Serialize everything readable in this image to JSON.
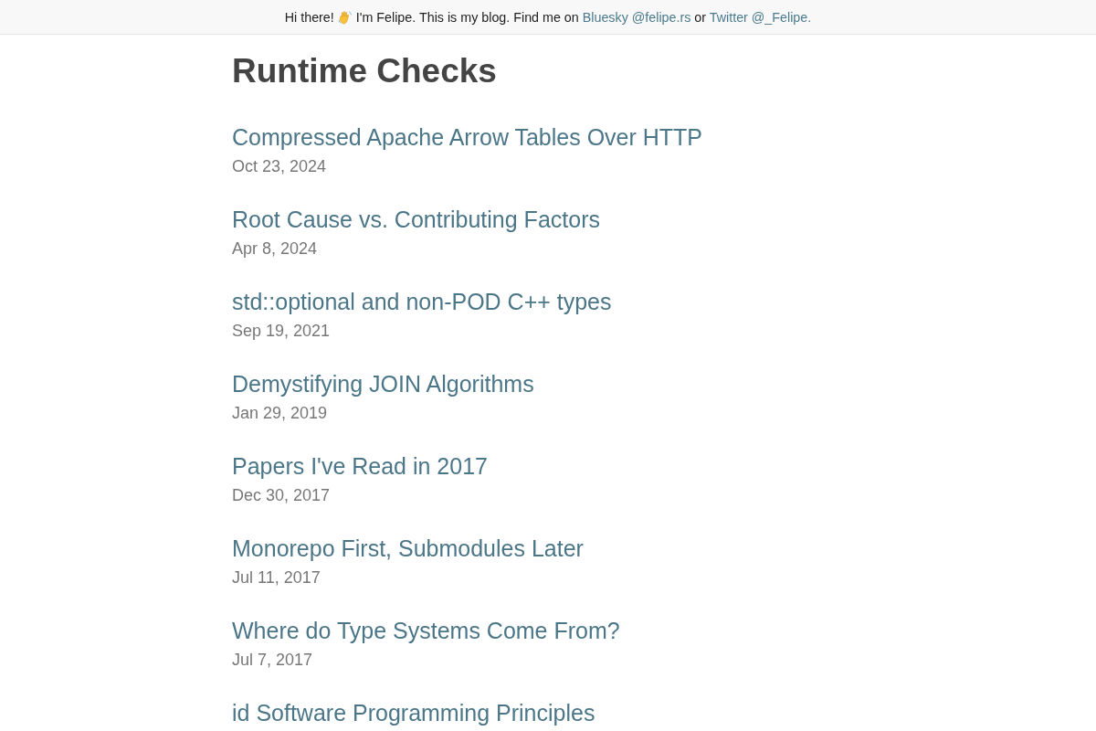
{
  "banner": {
    "greeting": "Hi there!",
    "intro": "I'm Felipe. This is my blog. Find me on",
    "links": [
      {
        "label": "Bluesky @felipe.rs"
      },
      {
        "label": "Twitter @_Felipe."
      }
    ],
    "conjunction": "or"
  },
  "heading": "Runtime Checks",
  "posts": [
    {
      "title": "Compressed Apache Arrow Tables Over HTTP",
      "date": "Oct 23, 2024"
    },
    {
      "title": "Root Cause vs. Contributing Factors",
      "date": "Apr 8, 2024"
    },
    {
      "title": "std::optional and non-POD C++ types",
      "date": "Sep 19, 2021"
    },
    {
      "title": "Demystifying JOIN Algorithms",
      "date": "Jan 29, 2019"
    },
    {
      "title": "Papers I've Read in 2017",
      "date": "Dec 30, 2017"
    },
    {
      "title": "Monorepo First, Submodules Later",
      "date": "Jul 11, 2017"
    },
    {
      "title": "Where do Type Systems Come From?",
      "date": "Jul 7, 2017"
    },
    {
      "title": "id Software Programming Principles"
    }
  ]
}
